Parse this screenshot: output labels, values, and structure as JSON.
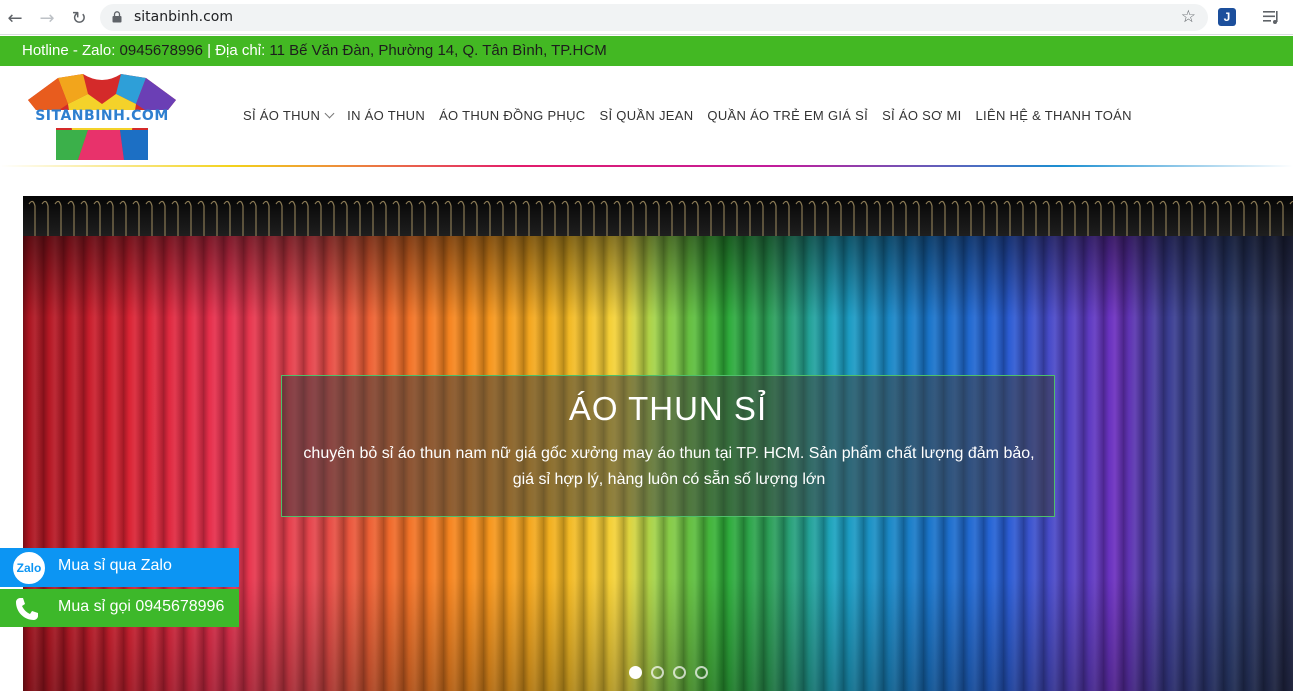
{
  "browser": {
    "url": "sitanbinh.com",
    "back_icon": "arrow-left-icon",
    "forward_icon": "arrow-right-icon",
    "reload_icon": "reload-icon",
    "extension_label": "J"
  },
  "topbar": {
    "hotline_label": "Hotline - Zalo: ",
    "hotline_value": "0945678996",
    "separator": " | ",
    "address_label": "Địa chỉ: ",
    "address_value": "11 Bế Văn Đàn, Phường 14, Q. Tân Bình, TP.HCM",
    "bg_color": "#43b823"
  },
  "header": {
    "logo_text": "SITANBINH.COM",
    "nav": [
      {
        "label": "SỈ ÁO THUN",
        "has_dropdown": true
      },
      {
        "label": "IN ÁO THUN"
      },
      {
        "label": "ÁO THUN ĐỒNG PHỤC"
      },
      {
        "label": "SỈ QUẦN JEAN"
      },
      {
        "label": "QUẦN ÁO TRẺ EM GIÁ SỈ"
      },
      {
        "label": "SỈ ÁO SƠ MI"
      },
      {
        "label": "LIÊN HỆ & THANH TOÁN"
      }
    ]
  },
  "hero": {
    "title": "ÁO THUN SỈ",
    "description": "chuyên bỏ sỉ áo thun nam nữ giá gốc xưởng may áo thun tại TP. HCM. Sản phẩm chất lượng đảm bảo, giá sỉ hợp lý, hàng luôn có sẵn số lượng lớn",
    "slide_count": 4,
    "active_slide": 0
  },
  "floating": {
    "zalo_label": "Mua sỉ qua Zalo",
    "zalo_icon_text": "Zalo",
    "phone_label": "Mua sỉ gọi 0945678996",
    "zalo_color": "#0c95f3",
    "phone_color": "#3db82a"
  }
}
